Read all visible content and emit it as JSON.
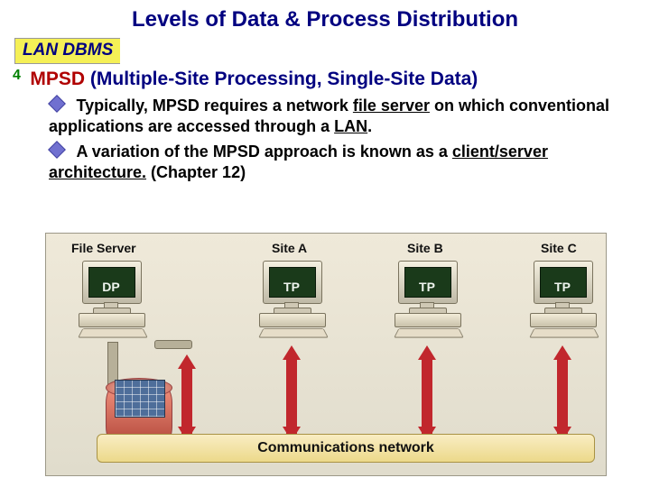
{
  "title": "Levels of Data & Process Distribution",
  "subhead": "LAN DBMS",
  "main": {
    "marker": "4",
    "label_red": "MPSD",
    "label_rest": " (Multiple-Site Processing, Single-Site Data)"
  },
  "bullets": [
    {
      "pre": "Typically, ",
      "body": "MPSD requires a network ",
      "u1": "file server",
      "body2": " on which conventional applications are accessed through a ",
      "u2": "LAN",
      "tail": "."
    },
    {
      "pre": "A ",
      "body": "variation of the MPSD approach is known as a ",
      "u1": "client/server architecture.",
      "body2": " (Chapter 12)",
      "u2": "",
      "tail": ""
    }
  ],
  "figure": {
    "fileserver_label": "File Server",
    "sites": [
      "Site A",
      "Site B",
      "Site C"
    ],
    "dp": "DP",
    "tp": "TP",
    "comm": "Communications network"
  }
}
